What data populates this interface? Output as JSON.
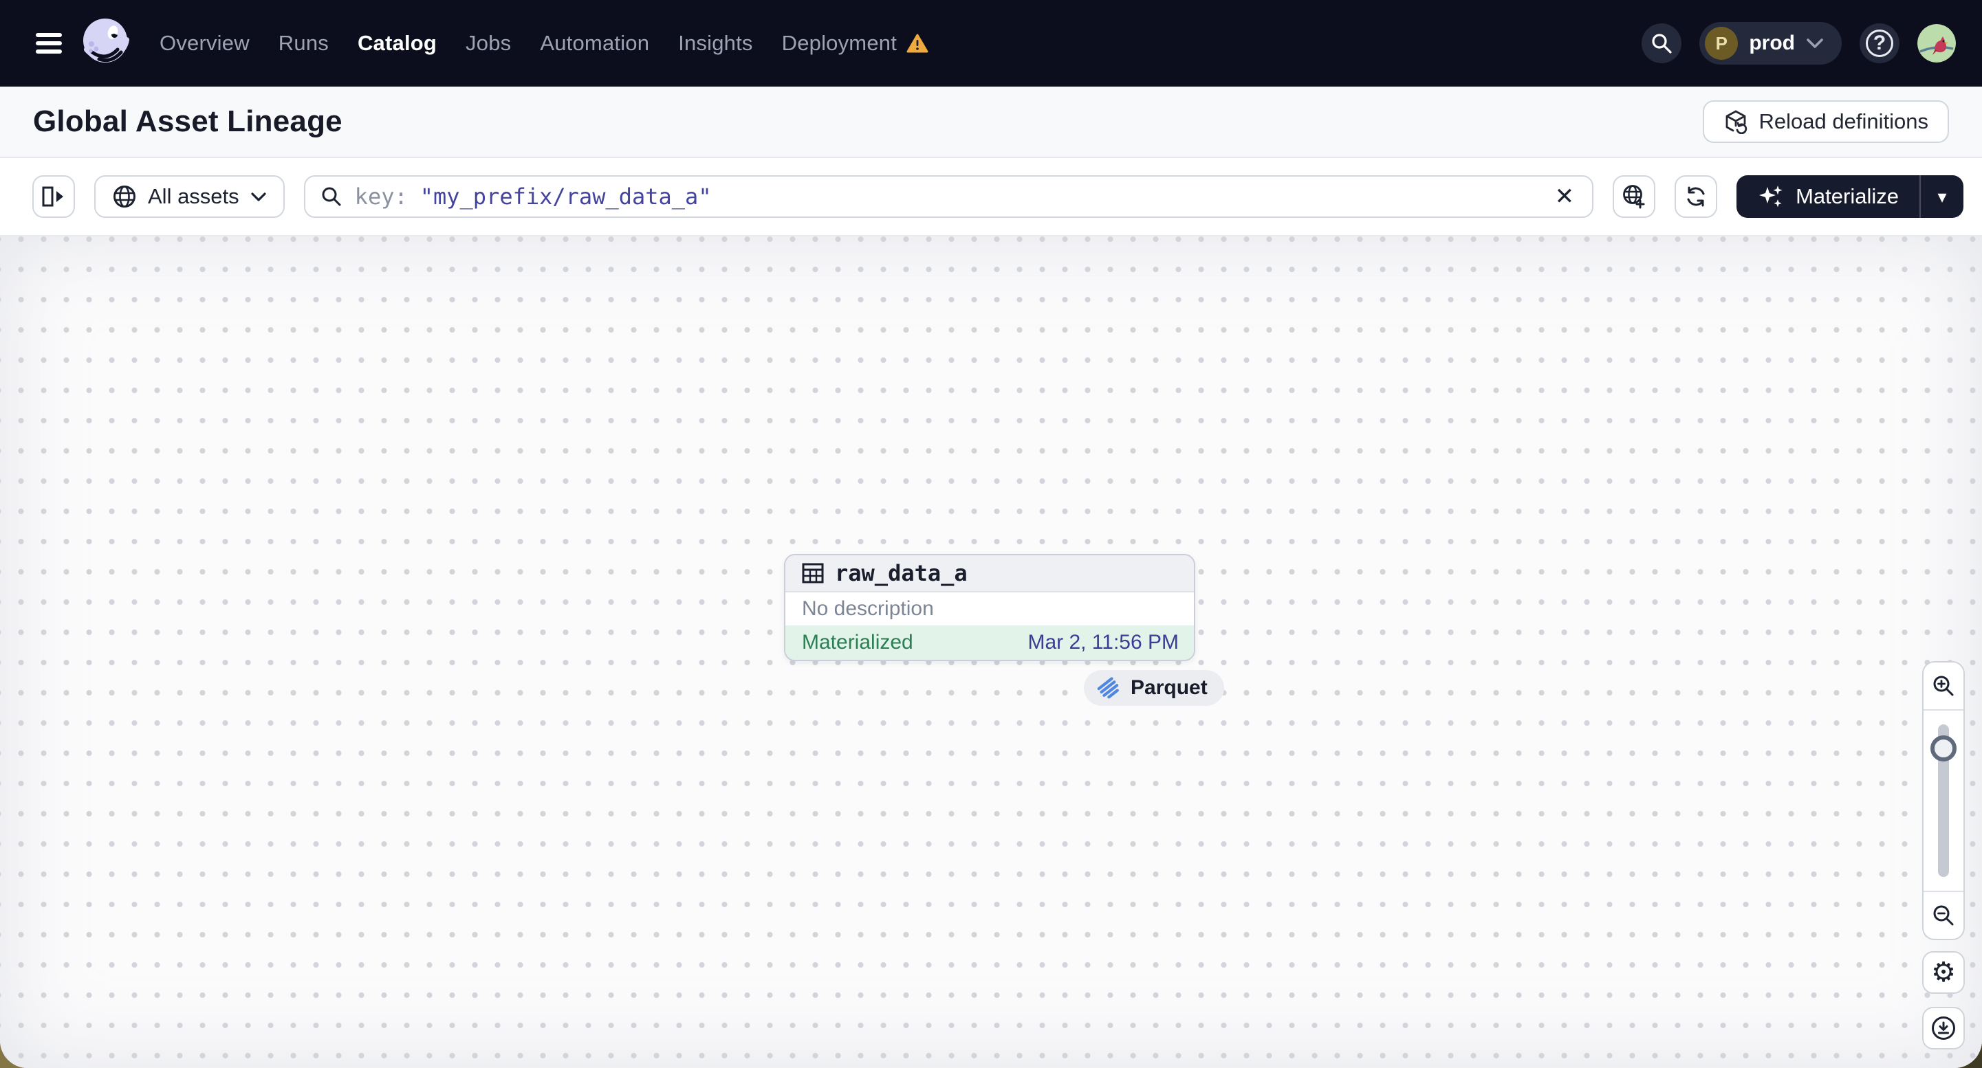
{
  "header": {
    "nav": [
      "Overview",
      "Runs",
      "Catalog",
      "Jobs",
      "Automation",
      "Insights",
      "Deployment"
    ],
    "active_tab": "Catalog",
    "environment": {
      "initial": "P",
      "name": "prod"
    }
  },
  "page": {
    "title": "Global Asset Lineage",
    "reload_label": "Reload definitions"
  },
  "toolbar": {
    "scope_label": "All assets",
    "search_key": "key:",
    "search_value": "\"my_prefix/raw_data_a\"",
    "materialize_label": "Materialize"
  },
  "graph": {
    "node": {
      "name": "raw_data_a",
      "description": "No description",
      "status": "Materialized",
      "materialized_at": "Mar 2, 11:56 PM",
      "storage_tag": "Parquet"
    }
  },
  "icons": {
    "close": "✕",
    "help": "?",
    "caret_down": "▾",
    "gear": "⚙"
  },
  "colors": {
    "topbar_bg": "#0c0e1d",
    "accent_dark": "#161b2d",
    "status_green_text": "#2c7e53",
    "status_green_bg": "#e2f3e9",
    "timestamp_indigo": "#3c3c98",
    "search_value_indigo": "#44449e",
    "warning_orange": "#f0a93c",
    "logo_lavender": "#d7d5f6",
    "parquet_blue": "#5087e0"
  }
}
